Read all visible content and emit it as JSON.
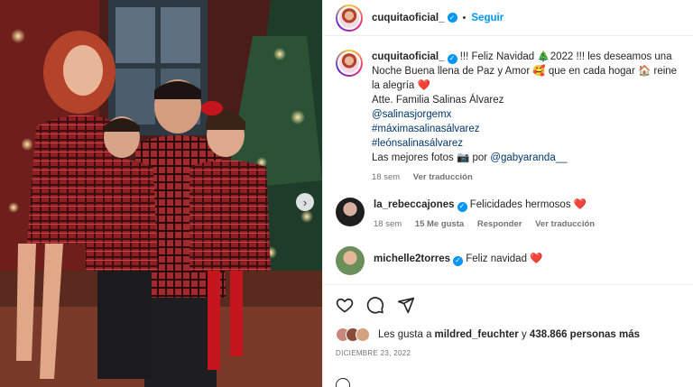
{
  "post_header": {
    "username": "cuquitaoficial_",
    "separator": "•",
    "follow_label": "Seguir"
  },
  "caption": {
    "username": "cuquitaoficial_",
    "line1": "!!! Feliz Navidad 🎄2022 !!! les deseamos una Noche Buena llena de Paz y Amor 🥰 que en cada hogar 🏠 reine la alegría ❤️",
    "signature": "Atte. Familia Salinas Álvarez",
    "tags": [
      "@salinasjorgemx",
      "#máximasalinasálvarez",
      "#leónsalinasálvarez"
    ],
    "photo_credit_prefix": "Las mejores fotos 📷 por ",
    "photo_credit_handle": "@gabyaranda__",
    "time": "18 sem",
    "translate": "Ver traducción"
  },
  "comments": [
    {
      "username": "la_rebeccajones",
      "text": "Felicidades hermosos",
      "heart": "❤️",
      "time": "18 sem",
      "likes": "15 Me gusta",
      "reply": "Responder",
      "translate": "Ver traducción"
    },
    {
      "username": "michelle2torres",
      "text": "Feliz navidad",
      "heart": "❤️"
    }
  ],
  "likes": {
    "prefix": "Les gusta a ",
    "user": "mildred_feuchter",
    "middle": " y ",
    "count": "438.866 personas más"
  },
  "date": "DICIEMBRE 23, 2022",
  "icons": {
    "like": "heart-outline-icon",
    "comment": "comment-bubble-icon",
    "share": "paper-plane-icon",
    "next": "chevron-right-icon",
    "verified": "verified-badge-icon"
  },
  "colors": {
    "link_blue": "#0095f6",
    "tag_blue": "#00376b",
    "heart_red": "#ed4956",
    "muted": "#737373"
  }
}
